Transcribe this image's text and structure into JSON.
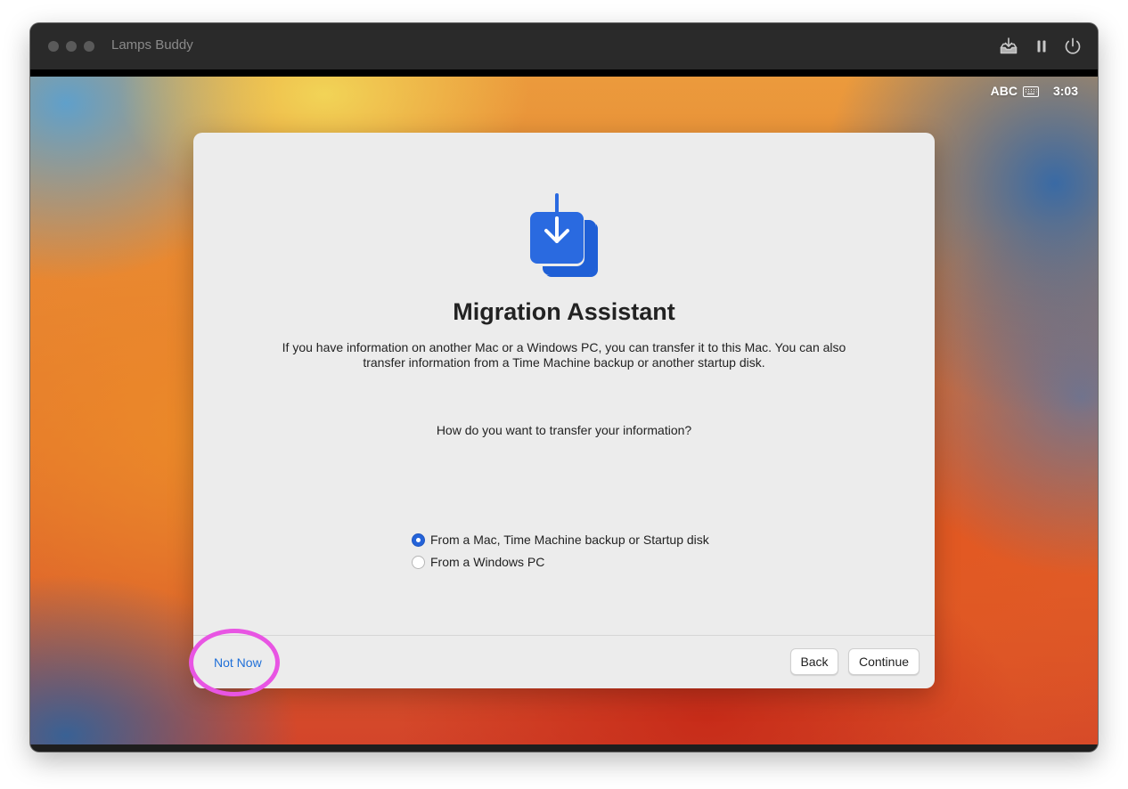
{
  "window": {
    "title": "Lamps Buddy",
    "toolbar_icons": [
      "download-tray-icon",
      "pause-icon",
      "power-icon"
    ]
  },
  "menubar": {
    "input_source": "ABC",
    "input_icon": "keyboard-icon",
    "clock": "3:03"
  },
  "dialog": {
    "icon": "migration-assistant-icon",
    "title": "Migration Assistant",
    "description": "If you have information on another Mac or a Windows PC, you can transfer it to this Mac. You can also transfer information from a Time Machine backup or another startup disk.",
    "question": "How do you want to transfer your information?",
    "options": [
      {
        "label": "From a Mac, Time Machine backup or Startup disk",
        "selected": true
      },
      {
        "label": "From a Windows PC",
        "selected": false
      }
    ],
    "not_now_label": "Not Now",
    "back_label": "Back",
    "continue_label": "Continue"
  },
  "colors": {
    "accent": "#2463d9",
    "link": "#1f6fd8",
    "highlight": "#e855e3"
  }
}
